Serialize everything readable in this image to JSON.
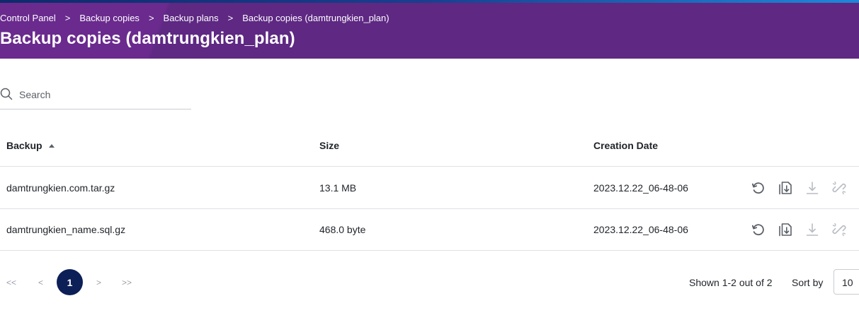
{
  "breadcrumb": [
    {
      "label": "Control Panel"
    },
    {
      "label": "Backup copies"
    },
    {
      "label": "Backup plans"
    },
    {
      "label": "Backup copies (damtrungkien_plan)"
    }
  ],
  "breadcrumb_separator": ">",
  "page_title": "Backup copies (damtrungkien_plan)",
  "search": {
    "placeholder": "Search",
    "value": ""
  },
  "table": {
    "columns": [
      "Backup",
      "Size",
      "Creation Date"
    ],
    "sort": {
      "column": "Backup",
      "direction": "ascending"
    },
    "rows": [
      {
        "backup": "damtrungkien.com.tar.gz",
        "size": "13.1 MB",
        "created": "2023.12.22_06-48-06"
      },
      {
        "backup": "damtrungkien_name.sql.gz",
        "size": "468.0 byte",
        "created": "2023.12.22_06-48-06"
      }
    ],
    "row_actions": [
      "restore-icon",
      "restore-file-icon",
      "download-icon",
      "unlink-icon"
    ]
  },
  "pagination": {
    "first": "<<",
    "prev": "<",
    "current": "1",
    "next": ">",
    "last": ">>"
  },
  "summary": "Shown 1-2 out of 2",
  "sort_by_label": "Sort by",
  "per_page": "10",
  "colors": {
    "header_bg": "#5e2883",
    "pager_active": "#0c1f56",
    "icon_active": "#5b6068",
    "icon_disabled": "#b8bcc3"
  }
}
